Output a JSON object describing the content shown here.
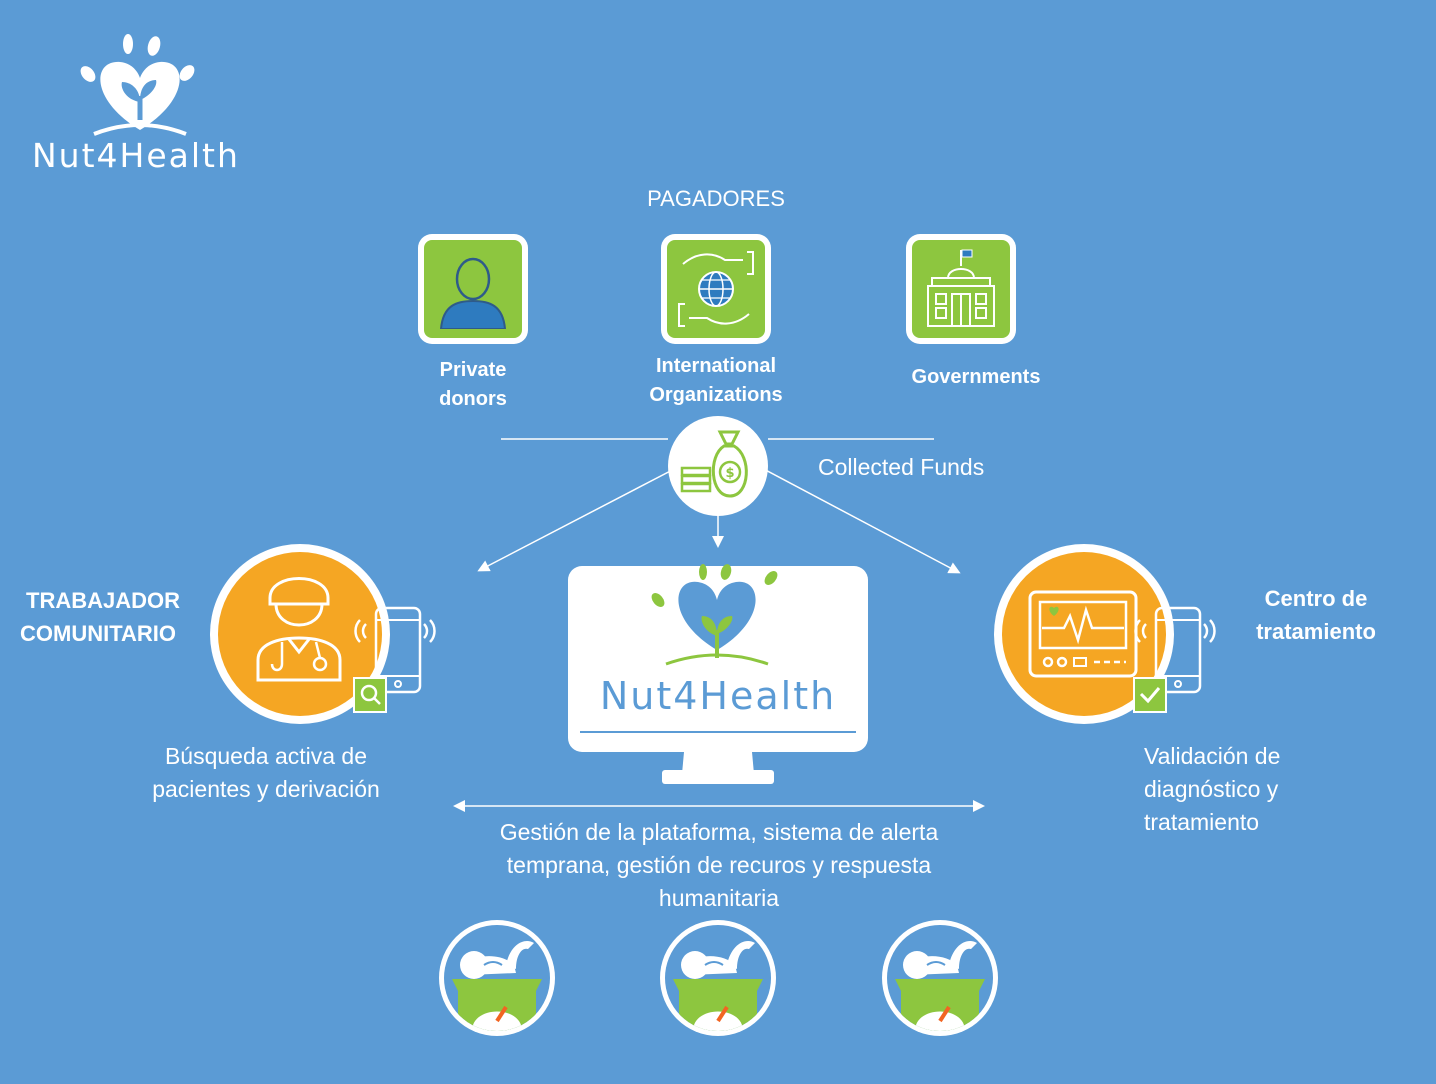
{
  "brand": {
    "name": "Nut4Health",
    "colors": {
      "background": "#5b9bd5",
      "green": "#8dc63f",
      "orange": "#f5a623",
      "blue": "#2e7bbf",
      "white": "#ffffff"
    }
  },
  "payers": {
    "title": "PAGADORES",
    "items": [
      {
        "icon": "person-icon",
        "label_line1": "Private",
        "label_line2": "donors"
      },
      {
        "icon": "globe-hands-icon",
        "label_line1": "International",
        "label_line2": "Organizations"
      },
      {
        "icon": "government-building-icon",
        "label_line1": "Governments",
        "label_line2": ""
      }
    ]
  },
  "funds": {
    "icon": "money-bag-icon",
    "label": "Collected Funds"
  },
  "community_worker": {
    "title_line1": "TRABAJADOR",
    "title_line2": "COMUNITARIO",
    "icon": "doctor-icon",
    "description_line1": "Búsqueda activa de",
    "description_line2": "pacientes y derivación"
  },
  "platform": {
    "icon": "monitor-icon",
    "logo_text": "Nut4Health",
    "description_line1": "Gestión de la plataforma, sistema de alerta",
    "description_line2": "temprana, gestión de recuros y respuesta",
    "description_line3": "humanitaria"
  },
  "treatment_center": {
    "title_line1": "Centro de",
    "title_line2": "tratamiento",
    "icon": "heart-monitor-icon",
    "description_line1": "Validación de",
    "description_line2": "diagnóstico y",
    "description_line3": "tratamiento"
  },
  "babies": [
    {
      "icon": "baby-scale-icon"
    },
    {
      "icon": "baby-scale-icon"
    },
    {
      "icon": "baby-scale-icon"
    }
  ]
}
